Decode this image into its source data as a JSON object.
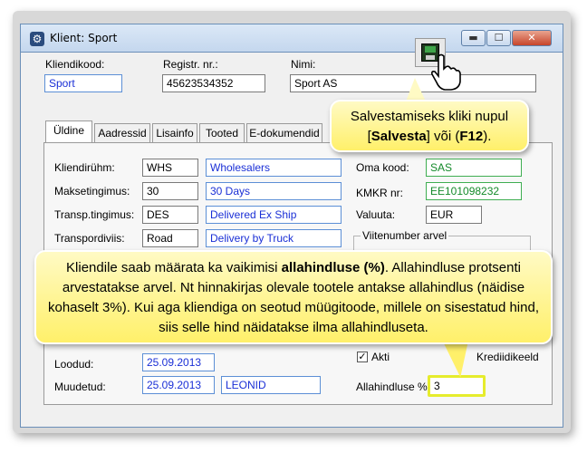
{
  "window": {
    "title": "Klient: Sport",
    "min_glyph": "▬",
    "max_glyph": "☐",
    "close_glyph": "✕"
  },
  "header": {
    "client_code_label": "Kliendikood:",
    "client_code_value": "Sport",
    "reg_no_label": "Registr. nr.:",
    "reg_no_value": "45623534352",
    "name_label": "Nimi:",
    "name_value": "Sport AS"
  },
  "tabs": [
    {
      "label": "Üldine"
    },
    {
      "label": "Aadressid"
    },
    {
      "label": "Lisainfo"
    },
    {
      "label": "Tooted"
    },
    {
      "label": "E-dokumendid"
    }
  ],
  "general": {
    "client_group_label": "Kliendirühm:",
    "client_group_code": "WHS",
    "client_group_name": "Wholesalers",
    "payment_terms_label": "Maksetingimus:",
    "payment_terms_code": "30",
    "payment_terms_name": "30 Days",
    "transport_terms_label": "Transp.tingimus:",
    "transport_terms_code": "DES",
    "transport_terms_name": "Delivered Ex Ship",
    "transport_mode_label": "Transpordiviis:",
    "transport_mode_code": "Road",
    "transport_mode_name": "Delivery by Truck",
    "own_code_label": "Oma kood:",
    "own_code_value": "SAS",
    "vat_no_label": "KMKR nr:",
    "vat_no_value": "EE101098232",
    "currency_label": "Valuuta:",
    "currency_value": "EUR",
    "reference_group_label": "Viitenumber arvel",
    "created_label": "Loodud:",
    "created_value": "25.09.2013",
    "modified_label": "Muudetud:",
    "modified_value": "25.09.2013",
    "modified_by_value": "LEONID",
    "active_label": "Akti",
    "credit_limit_label": "Krediidikeeld",
    "discount_label": "Allahindluse %:",
    "discount_value": "3"
  },
  "callouts": {
    "save_line1": "Salvestamiseks kliki nupul",
    "save_line2_pre": "[",
    "save_line2_bold1": "Salvesta",
    "save_line2_mid": "] või (",
    "save_line2_bold2": "F12",
    "save_line2_post": ").",
    "discount_pre": "Kliendile saab määrata ka vaikimisi ",
    "discount_bold": "allahindluse (%)",
    "discount_post": ".  Allahindluse protsenti arvestatakse arvel. Nt hinnakirjas olevale tootele antakse allahindlus (näidise kohaselt 3%).  Kui aga kliendiga on seotud müügitoode, millele on sisestatud hind, siis selle hind näidatakse ilma allahindluseta."
  }
}
